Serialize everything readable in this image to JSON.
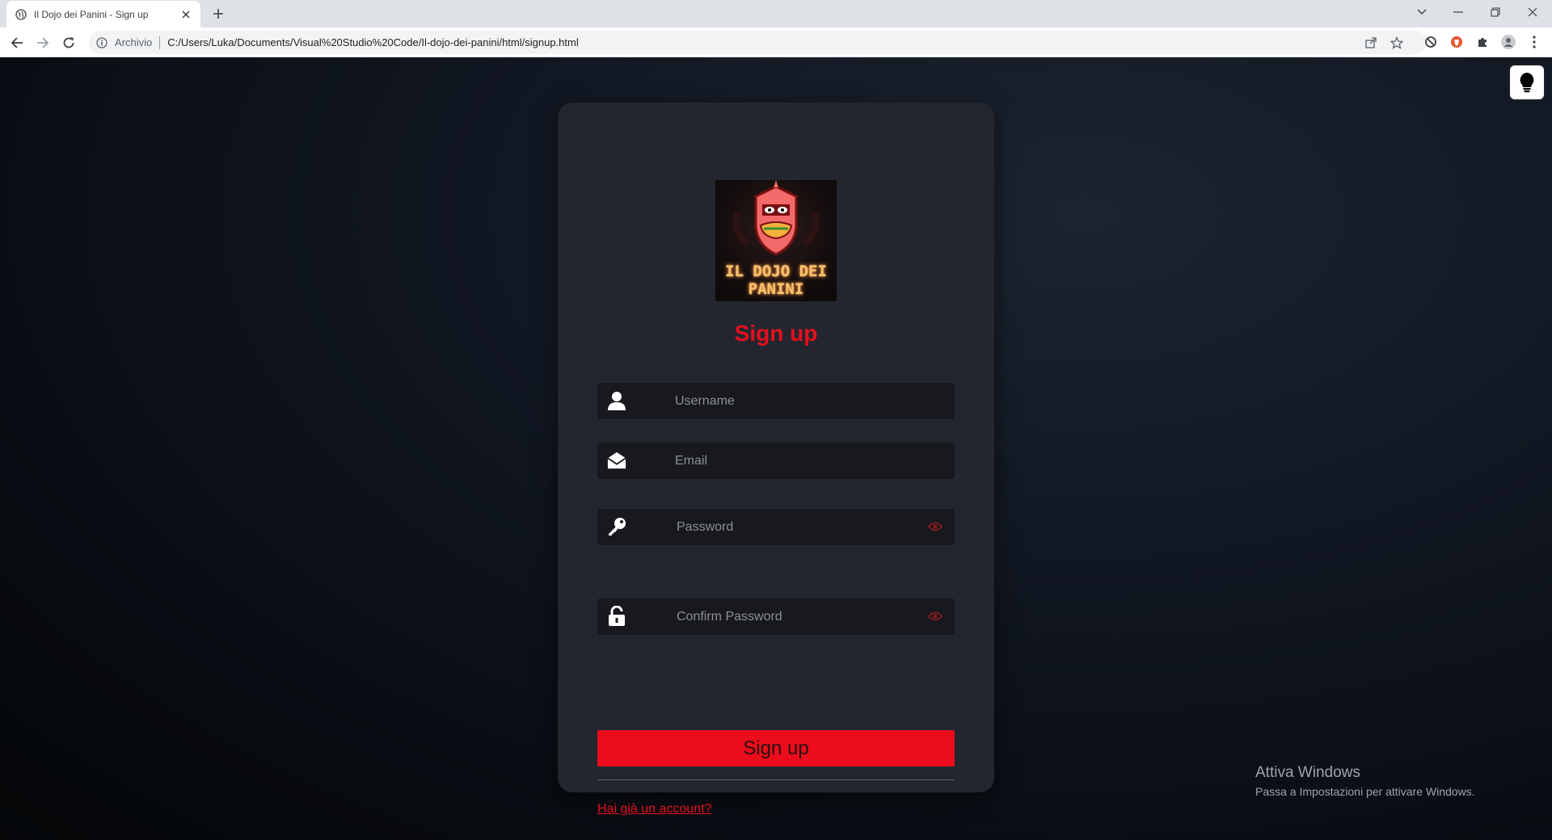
{
  "browser": {
    "tab_title": "Il Dojo dei Panini - Sign up",
    "omnibox_label": "Archivio",
    "url": "C:/Users/Luka/Documents/Visual%20Studio%20Code/Il-dojo-dei-panini/html/signup.html"
  },
  "signup": {
    "logo_line1": "IL DOJO DEI",
    "logo_line2": "PANINI",
    "title": "Sign up",
    "username_placeholder": "Username",
    "email_placeholder": "Email",
    "password_placeholder": "Password",
    "confirm_placeholder": "Confirm Password",
    "submit_label": "Sign up",
    "login_link": "Hai già un account?"
  },
  "watermark": {
    "title": "Attiva Windows",
    "subtitle": "Passa a Impostazioni per attivare Windows."
  },
  "colors": {
    "accent": "#e60f1e",
    "card": "#23262e",
    "input": "#17191f"
  },
  "icons": [
    "globe-icon",
    "close-icon",
    "plus-icon",
    "chevron-down-icon",
    "minimize-icon",
    "restore-icon",
    "back-icon",
    "forward-icon",
    "reload-icon",
    "info-icon",
    "share-icon",
    "star-icon",
    "block-icon",
    "brave-icon",
    "puzzle-icon",
    "profile-icon",
    "kebab-icon",
    "lightbulb-icon",
    "user-icon",
    "envelope-icon",
    "key-icon",
    "unlock-icon",
    "eye-icon"
  ]
}
